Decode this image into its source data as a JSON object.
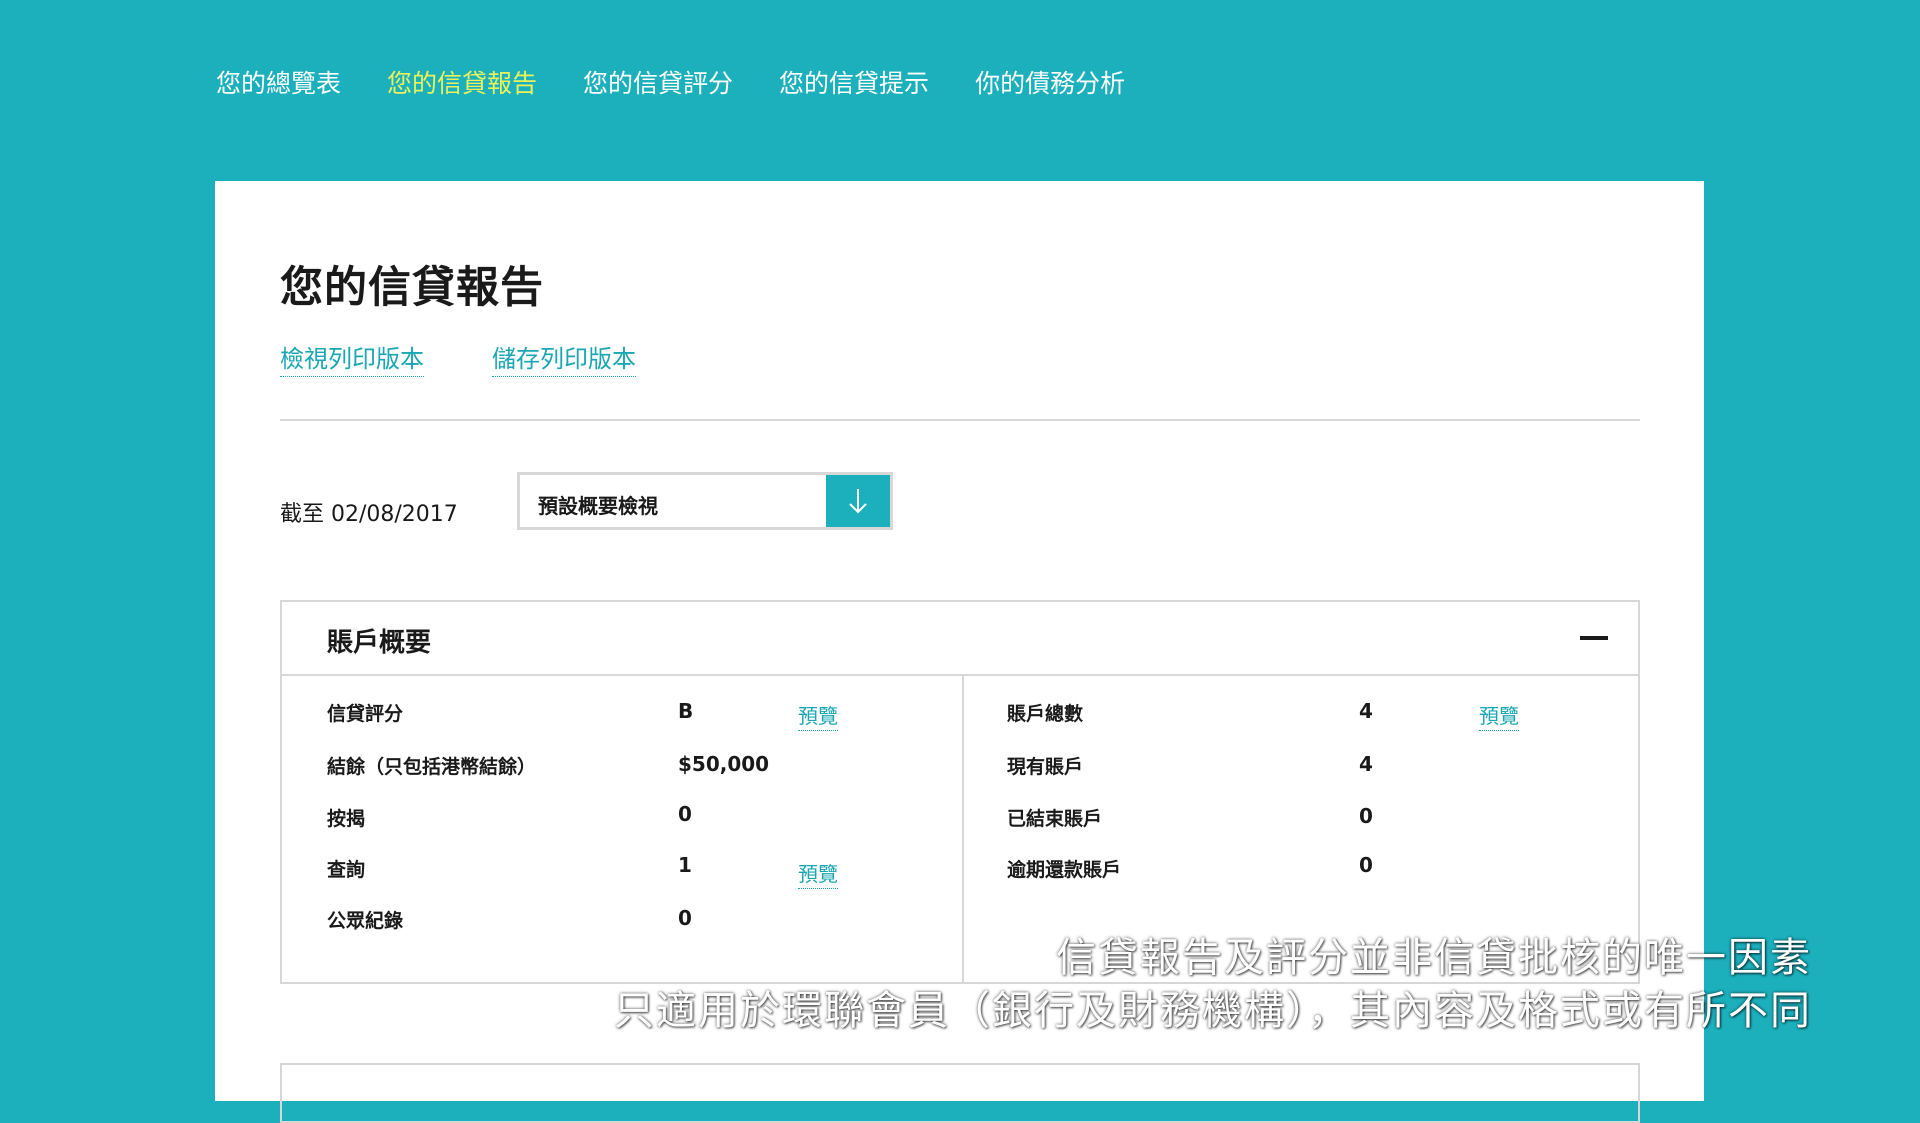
{
  "nav": {
    "items": [
      {
        "label": "您的總覽表"
      },
      {
        "label": "您的信貸報告"
      },
      {
        "label": "您的信貸評分"
      },
      {
        "label": "您的信貸提示"
      },
      {
        "label": "你的債務分析"
      }
    ],
    "active_index": 1
  },
  "page": {
    "title": "您的信貸報告",
    "view_print_label": "檢視列印版本",
    "save_print_label": "儲存列印版本",
    "as_of": "截至 02/08/2017",
    "view_select_value": "預設概要檢視"
  },
  "summary": {
    "title": "賬戶概要",
    "left": [
      {
        "label": "信貸評分",
        "value": "B",
        "link": "預覽"
      },
      {
        "label": "結餘（只包括港幣結餘）",
        "value": "$50,000",
        "link": ""
      },
      {
        "label": "按揭",
        "value": "0",
        "link": ""
      },
      {
        "label": "查詢",
        "value": "1",
        "link": "預覽"
      },
      {
        "label": "公眾紀錄",
        "value": "0",
        "link": ""
      }
    ],
    "right": [
      {
        "label": "賬戶總數",
        "value": "4",
        "link": "預覽"
      },
      {
        "label": "現有賬戶",
        "value": "4",
        "link": ""
      },
      {
        "label": "已結束賬戶",
        "value": "0",
        "link": ""
      },
      {
        "label": "逾期還款賬戶",
        "value": "0",
        "link": ""
      }
    ]
  },
  "subtitles": {
    "line1": "信貸報告及評分並非信貸批核的唯一因素",
    "line2": "只適用於環聯會員（銀行及財務機構），其內容及格式或有所不同"
  },
  "colors": {
    "background": "#1cb0bd",
    "active_nav": "#e9f25a",
    "link": "#1aa6b3"
  },
  "icons": {
    "select_button": "arrow-down-icon",
    "collapse": "minus-icon"
  }
}
